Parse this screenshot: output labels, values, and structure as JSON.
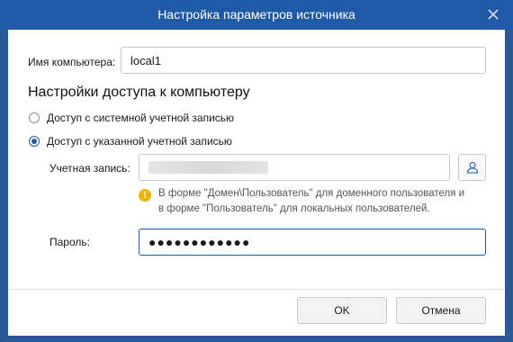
{
  "window": {
    "title": "Настройка параметров источника",
    "close_icon": "close-icon"
  },
  "computer": {
    "label": "Имя компьютера:",
    "value": "local1"
  },
  "access": {
    "section_title": "Настройки доступа к компьютеру",
    "options": [
      {
        "label": "Доступ с системной учетной записью",
        "checked": false
      },
      {
        "label": "Доступ с указанной учетной записью",
        "checked": true
      }
    ]
  },
  "account": {
    "label": "Учетная запись:",
    "value": "",
    "user_button_icon": "user-icon"
  },
  "hint": {
    "icon": "warning-icon",
    "line1": "В форме \"Домен\\Пользователь\" для доменного пользователя и",
    "line2": "в форме \"Пользователь\" для локальных пользователей."
  },
  "password": {
    "label": "Пароль:",
    "value": "●●●●●●●●●●●●"
  },
  "buttons": {
    "ok": "OK",
    "cancel": "Отмена"
  },
  "colors": {
    "title_bar": "#1f5aa6",
    "accent": "#1f5aa6",
    "warning": "#f0b400"
  }
}
